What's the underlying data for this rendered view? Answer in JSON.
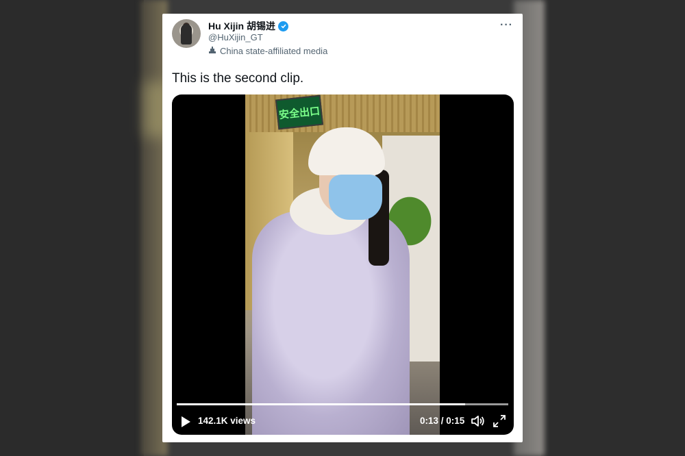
{
  "tweet": {
    "display_name": "Hu Xijin 胡锡进",
    "handle": "@HuXijin_GT",
    "account_label": "China state-affiliated media",
    "text": "This is the second clip.",
    "more_menu": "···"
  },
  "video": {
    "sign_text": "安全出口",
    "views": "142.1K views",
    "elapsed": "0:13",
    "duration": "0:15",
    "time_display": "0:13 / 0:15",
    "progress_fraction": 0.87
  },
  "colors": {
    "verified": "#1d9bf0",
    "name": "#0f1419",
    "muted": "#536471",
    "video_bg": "#000000"
  },
  "icons": [
    "verified-badge-icon",
    "state-media-icon",
    "more-icon",
    "play-icon",
    "volume-icon",
    "fullscreen-icon"
  ]
}
